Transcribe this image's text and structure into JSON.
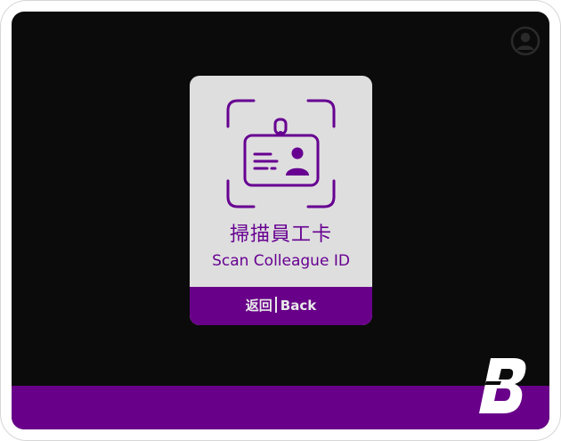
{
  "colors": {
    "screen_background": "#0b0b0b",
    "accent_purple": "#680089",
    "card_background": "#dedede",
    "text_light": "#e9e9e9"
  },
  "header": {
    "profile_icon": "user-circle-icon"
  },
  "scan_card": {
    "icon": "id-badge-scan-icon",
    "title_zh": "掃描員工卡",
    "title_en": "Scan Colleague ID",
    "back_zh": "返回",
    "back_en": "Back"
  },
  "footer": {
    "logo_icon": "brand-b-logo-icon"
  }
}
